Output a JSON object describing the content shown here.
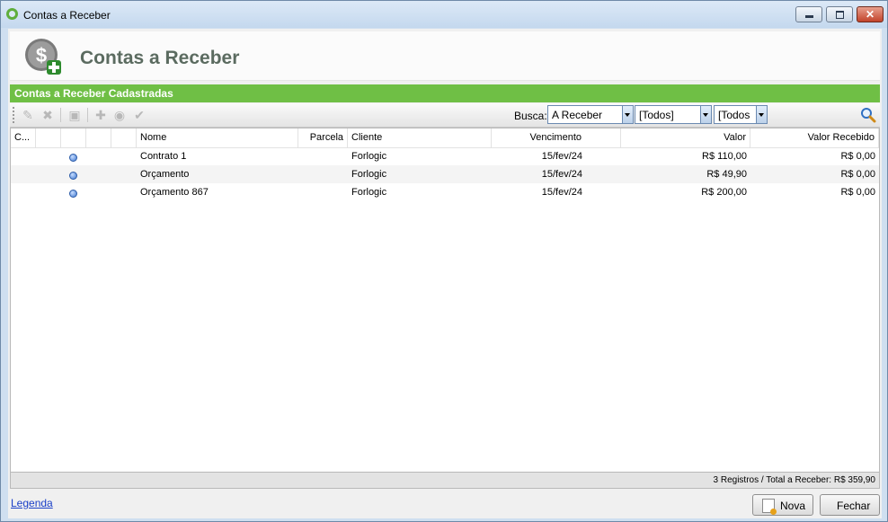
{
  "window": {
    "title": "Contas a Receber"
  },
  "header": {
    "title": "Contas a Receber"
  },
  "section": {
    "title": "Contas a Receber Cadastradas"
  },
  "toolbar": {
    "busca_label": "Busca:",
    "filters": [
      "A Receber",
      "[Todos]",
      "[Todos"
    ]
  },
  "table": {
    "columns": [
      "C...",
      "",
      "",
      "",
      "",
      "Nome",
      "Parcela",
      "Cliente",
      "Vencimento",
      "Valor",
      "Valor Recebido"
    ],
    "rows": [
      {
        "nome": "Contrato 1",
        "parcela": "",
        "cliente": "Forlogic",
        "vencimento": "15/fev/24",
        "valor": "R$ 110,00",
        "valor_recebido": "R$ 0,00"
      },
      {
        "nome": "Orçamento",
        "parcela": "",
        "cliente": "Forlogic",
        "vencimento": "15/fev/24",
        "valor": "R$ 49,90",
        "valor_recebido": "R$ 0,00"
      },
      {
        "nome": "Orçamento 867",
        "parcela": "",
        "cliente": "Forlogic",
        "vencimento": "15/fev/24",
        "valor": "R$ 200,00",
        "valor_recebido": "R$ 0,00"
      }
    ]
  },
  "status": {
    "summary": "3 Registros / Total a Receber: R$ 359,90"
  },
  "footer": {
    "legend_link": "Legenda",
    "nova_label": "Nova",
    "fechar_label": "Fechar"
  }
}
